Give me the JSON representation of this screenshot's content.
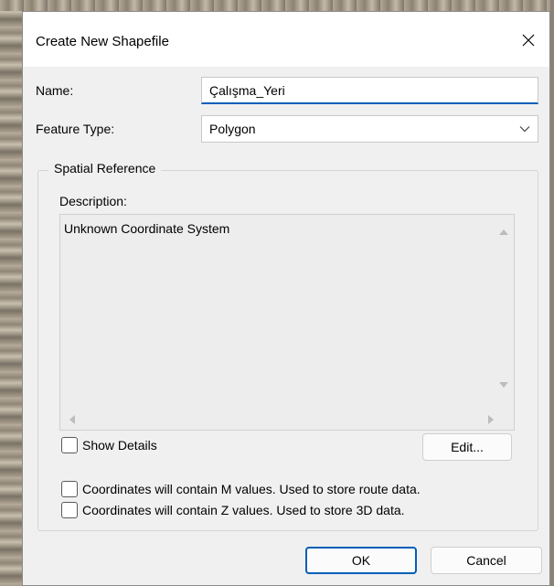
{
  "dialog": {
    "title": "Create New Shapefile"
  },
  "form": {
    "name_label": "Name:",
    "name_value": "Çalışma_Yeri",
    "feature_type_label": "Feature Type:",
    "feature_type_value": "Polygon"
  },
  "spatial_reference": {
    "group_title": "Spatial Reference",
    "description_label": "Description:",
    "description_text": "Unknown Coordinate System",
    "show_details_label": "Show Details",
    "show_details_checked": false,
    "edit_button_label": "Edit..."
  },
  "options": {
    "m_values_label": "Coordinates will contain M values. Used to store route data.",
    "m_values_checked": false,
    "z_values_label": "Coordinates will contain Z values. Used to store 3D data.",
    "z_values_checked": false
  },
  "buttons": {
    "ok_label": "OK",
    "cancel_label": "Cancel"
  },
  "colors": {
    "accent": "#005fb8",
    "dialog_bg": "#f0f0f0",
    "titlebar_bg": "#ffffff"
  },
  "icons": {
    "close": "close-icon",
    "dropdown": "chevron-down-icon",
    "scroll_up": "scroll-up-arrow-icon",
    "scroll_down": "scroll-down-arrow-icon",
    "scroll_left": "scroll-left-arrow-icon",
    "scroll_right": "scroll-right-arrow-icon"
  }
}
